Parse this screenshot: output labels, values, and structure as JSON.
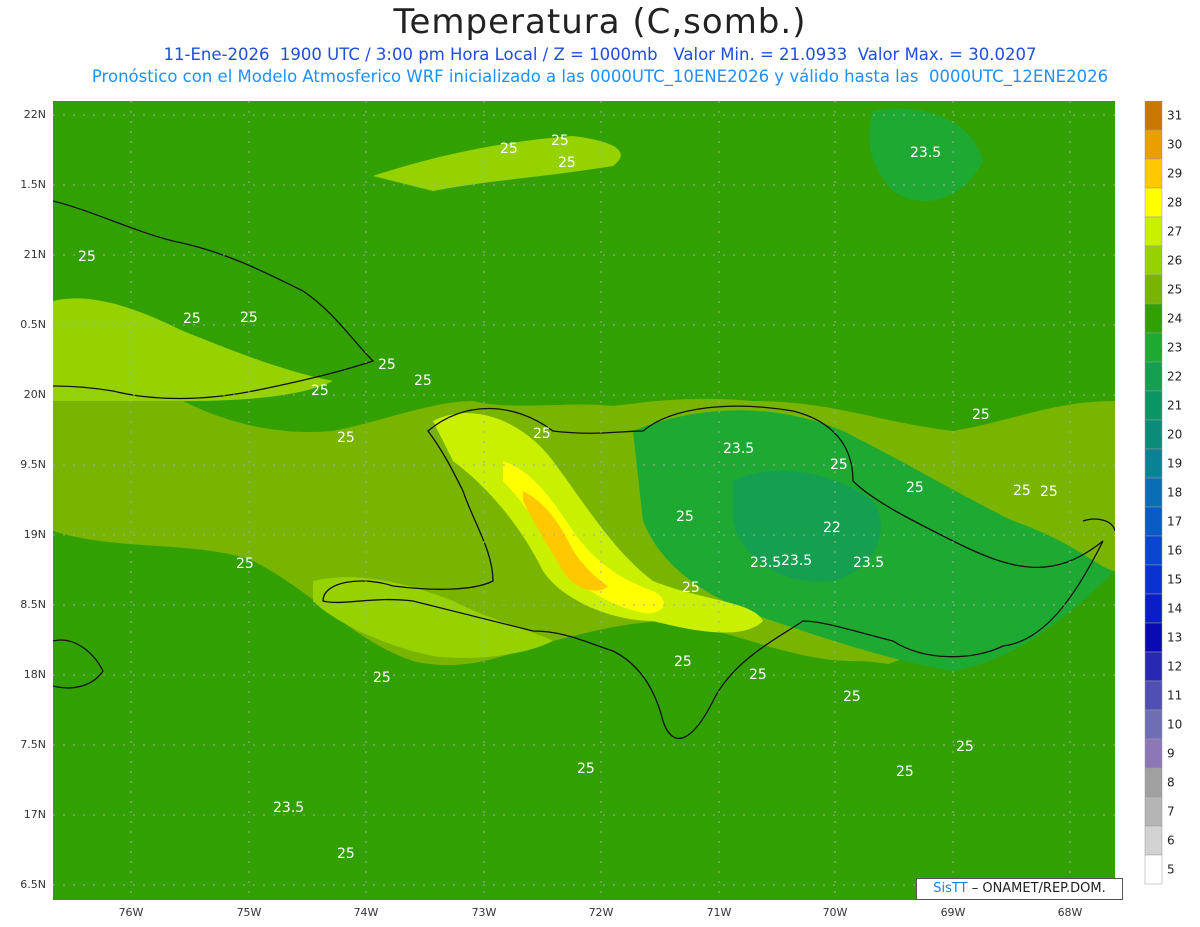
{
  "header": {
    "title": "Temperatura (C,somb.)",
    "line1": "11-Ene-2026  1900 UTC / 3:00 pm Hora Local / Z = 1000mb   Valor Min. = 21.0933  Valor Max. = 30.0207",
    "line2": "Pronóstico con el Modelo Atmosferico WRF inicializado a las 0000UTC_10ENE2026 y válido hasta las  0000UTC_12ENE2026"
  },
  "lat_labels": [
    "22N",
    "21.5N",
    "21N",
    "20.5N",
    "20N",
    "19.5N",
    "19N",
    "18.5N",
    "18N",
    "17.5N",
    "17N",
    "16.5N"
  ],
  "lat_labels_display": [
    "22N",
    "1.5N",
    "21N",
    "0.5N",
    "20N",
    "9.5N",
    "19N",
    "8.5N",
    "18N",
    "7.5N",
    "17N",
    "6.5N"
  ],
  "lon_labels": [
    "76W",
    "75W",
    "74W",
    "73W",
    "72W",
    "71W",
    "70W",
    "69W",
    "68W"
  ],
  "colorbar": {
    "labels": [
      "31",
      "30",
      "29",
      "28",
      "27",
      "26",
      "25",
      "24",
      "23",
      "22",
      "21",
      "20",
      "19",
      "18",
      "17",
      "16",
      "15",
      "14",
      "13",
      "12",
      "11",
      "10",
      "9",
      "8",
      "7",
      "6",
      "5"
    ],
    "colors": [
      "#c87800",
      "#e8a000",
      "#ffc800",
      "#ffff00",
      "#c8f000",
      "#96d200",
      "#78b400",
      "#32a000",
      "#1eaa32",
      "#14a050",
      "#0a9664",
      "#0a8c78",
      "#0a8296",
      "#0a6eb4",
      "#0a5ac8",
      "#0a46d2",
      "#0a32d2",
      "#0a1ec8",
      "#0a0ab4",
      "#2828b4",
      "#5050b4",
      "#6e6eb4",
      "#8c78b4",
      "#a0a0a0",
      "#b4b4b4",
      "#d2d2d2",
      "#ffffff"
    ]
  },
  "contour_labels": [
    "25",
    "25",
    "25",
    "25",
    "25",
    "25",
    "25",
    "25",
    "25",
    "25",
    "25",
    "25",
    "23.5",
    "23.5",
    "23.5",
    "23.5",
    "23.5",
    "22",
    "25",
    "25",
    "25",
    "25",
    "25",
    "25",
    "25",
    "25",
    "25",
    "25",
    "25",
    "25",
    "23.5",
    "25",
    "25",
    "25"
  ],
  "credit": {
    "brand": "SisTT",
    "text": "– ONAMET/REP.DOM."
  }
}
